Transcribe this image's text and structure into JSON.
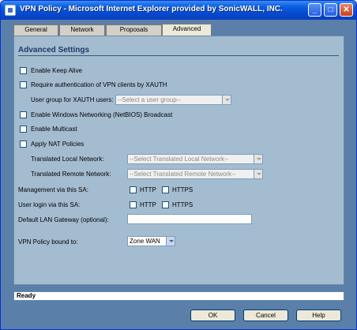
{
  "window": {
    "title": "VPN Policy - Microsoft Internet Explorer provided by SonicWALL, INC.",
    "minimize_glyph": "_",
    "maximize_glyph": "□",
    "close_glyph": "✕"
  },
  "tabs": [
    {
      "label": "General",
      "active": false
    },
    {
      "label": "Network",
      "active": false
    },
    {
      "label": "Proposals",
      "active": false
    },
    {
      "label": "Advanced",
      "active": true
    }
  ],
  "advanced": {
    "section_title": "Advanced Settings",
    "enable_keep_alive": "Enable Keep Alive",
    "require_xauth": "Require authentication of VPN clients by XAUTH",
    "user_group_label": "User group for XAUTH users:",
    "user_group_select": "--Select a user group--",
    "enable_netbios": "Enable Windows Networking (NetBIOS) Broadcast",
    "enable_multicast": "Enable Multicast",
    "apply_nat": "Apply NAT Policies",
    "translated_local_label": "Translated Local Network:",
    "translated_local_select": "--Select Translated Local Network--",
    "translated_remote_label": "Translated Remote Network:",
    "translated_remote_select": "--Select Translated Remote Network--",
    "management_label": "Management via this SA:",
    "user_login_label": "User login via this SA:",
    "http": "HTTP",
    "https": "HTTPS",
    "default_gateway_label": "Default LAN Gateway (optional):",
    "default_gateway_value": "",
    "bound_to_label": "VPN Policy bound to:",
    "bound_to_select": "Zone WAN"
  },
  "status": {
    "text": "Ready"
  },
  "buttons": {
    "ok": "OK",
    "cancel": "Cancel",
    "help": "Help"
  }
}
